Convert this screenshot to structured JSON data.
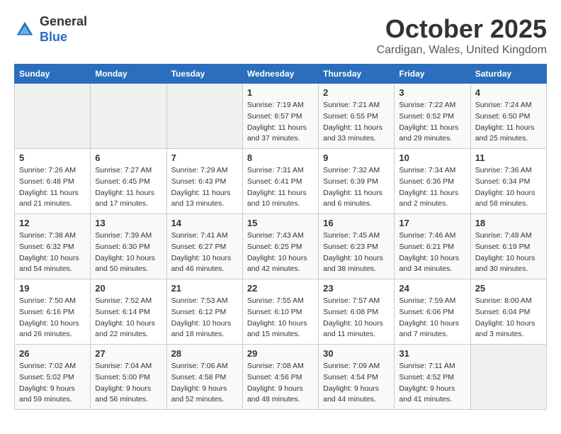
{
  "header": {
    "logo_general": "General",
    "logo_blue": "Blue",
    "month_title": "October 2025",
    "location": "Cardigan, Wales, United Kingdom"
  },
  "weekdays": [
    "Sunday",
    "Monday",
    "Tuesday",
    "Wednesday",
    "Thursday",
    "Friday",
    "Saturday"
  ],
  "weeks": [
    [
      {
        "day": "",
        "info": ""
      },
      {
        "day": "",
        "info": ""
      },
      {
        "day": "",
        "info": ""
      },
      {
        "day": "1",
        "info": "Sunrise: 7:19 AM\nSunset: 6:57 PM\nDaylight: 11 hours\nand 37 minutes."
      },
      {
        "day": "2",
        "info": "Sunrise: 7:21 AM\nSunset: 6:55 PM\nDaylight: 11 hours\nand 33 minutes."
      },
      {
        "day": "3",
        "info": "Sunrise: 7:22 AM\nSunset: 6:52 PM\nDaylight: 11 hours\nand 29 minutes."
      },
      {
        "day": "4",
        "info": "Sunrise: 7:24 AM\nSunset: 6:50 PM\nDaylight: 11 hours\nand 25 minutes."
      }
    ],
    [
      {
        "day": "5",
        "info": "Sunrise: 7:26 AM\nSunset: 6:48 PM\nDaylight: 11 hours\nand 21 minutes."
      },
      {
        "day": "6",
        "info": "Sunrise: 7:27 AM\nSunset: 6:45 PM\nDaylight: 11 hours\nand 17 minutes."
      },
      {
        "day": "7",
        "info": "Sunrise: 7:29 AM\nSunset: 6:43 PM\nDaylight: 11 hours\nand 13 minutes."
      },
      {
        "day": "8",
        "info": "Sunrise: 7:31 AM\nSunset: 6:41 PM\nDaylight: 11 hours\nand 10 minutes."
      },
      {
        "day": "9",
        "info": "Sunrise: 7:32 AM\nSunset: 6:39 PM\nDaylight: 11 hours\nand 6 minutes."
      },
      {
        "day": "10",
        "info": "Sunrise: 7:34 AM\nSunset: 6:36 PM\nDaylight: 11 hours\nand 2 minutes."
      },
      {
        "day": "11",
        "info": "Sunrise: 7:36 AM\nSunset: 6:34 PM\nDaylight: 10 hours\nand 58 minutes."
      }
    ],
    [
      {
        "day": "12",
        "info": "Sunrise: 7:38 AM\nSunset: 6:32 PM\nDaylight: 10 hours\nand 54 minutes."
      },
      {
        "day": "13",
        "info": "Sunrise: 7:39 AM\nSunset: 6:30 PM\nDaylight: 10 hours\nand 50 minutes."
      },
      {
        "day": "14",
        "info": "Sunrise: 7:41 AM\nSunset: 6:27 PM\nDaylight: 10 hours\nand 46 minutes."
      },
      {
        "day": "15",
        "info": "Sunrise: 7:43 AM\nSunset: 6:25 PM\nDaylight: 10 hours\nand 42 minutes."
      },
      {
        "day": "16",
        "info": "Sunrise: 7:45 AM\nSunset: 6:23 PM\nDaylight: 10 hours\nand 38 minutes."
      },
      {
        "day": "17",
        "info": "Sunrise: 7:46 AM\nSunset: 6:21 PM\nDaylight: 10 hours\nand 34 minutes."
      },
      {
        "day": "18",
        "info": "Sunrise: 7:48 AM\nSunset: 6:19 PM\nDaylight: 10 hours\nand 30 minutes."
      }
    ],
    [
      {
        "day": "19",
        "info": "Sunrise: 7:50 AM\nSunset: 6:16 PM\nDaylight: 10 hours\nand 26 minutes."
      },
      {
        "day": "20",
        "info": "Sunrise: 7:52 AM\nSunset: 6:14 PM\nDaylight: 10 hours\nand 22 minutes."
      },
      {
        "day": "21",
        "info": "Sunrise: 7:53 AM\nSunset: 6:12 PM\nDaylight: 10 hours\nand 18 minutes."
      },
      {
        "day": "22",
        "info": "Sunrise: 7:55 AM\nSunset: 6:10 PM\nDaylight: 10 hours\nand 15 minutes."
      },
      {
        "day": "23",
        "info": "Sunrise: 7:57 AM\nSunset: 6:08 PM\nDaylight: 10 hours\nand 11 minutes."
      },
      {
        "day": "24",
        "info": "Sunrise: 7:59 AM\nSunset: 6:06 PM\nDaylight: 10 hours\nand 7 minutes."
      },
      {
        "day": "25",
        "info": "Sunrise: 8:00 AM\nSunset: 6:04 PM\nDaylight: 10 hours\nand 3 minutes."
      }
    ],
    [
      {
        "day": "26",
        "info": "Sunrise: 7:02 AM\nSunset: 5:02 PM\nDaylight: 9 hours\nand 59 minutes."
      },
      {
        "day": "27",
        "info": "Sunrise: 7:04 AM\nSunset: 5:00 PM\nDaylight: 9 hours\nand 56 minutes."
      },
      {
        "day": "28",
        "info": "Sunrise: 7:06 AM\nSunset: 4:58 PM\nDaylight: 9 hours\nand 52 minutes."
      },
      {
        "day": "29",
        "info": "Sunrise: 7:08 AM\nSunset: 4:56 PM\nDaylight: 9 hours\nand 48 minutes."
      },
      {
        "day": "30",
        "info": "Sunrise: 7:09 AM\nSunset: 4:54 PM\nDaylight: 9 hours\nand 44 minutes."
      },
      {
        "day": "31",
        "info": "Sunrise: 7:11 AM\nSunset: 4:52 PM\nDaylight: 9 hours\nand 41 minutes."
      },
      {
        "day": "",
        "info": ""
      }
    ]
  ]
}
